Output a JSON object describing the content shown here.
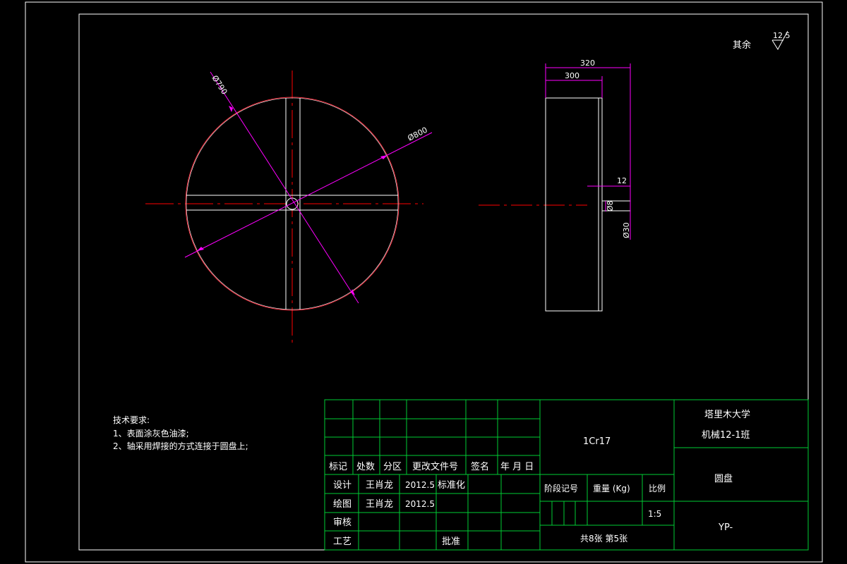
{
  "colors": {
    "background": "#000000",
    "outline": "#ffffff",
    "dimension": "#ff00ff",
    "centerline": "#ff0000",
    "grid": "#00cc33"
  },
  "roughness": {
    "label": "其余",
    "value": "12.5"
  },
  "front_view": {
    "dim_diameter_790": "Ø790",
    "dim_diameter_800": "Ø800"
  },
  "side_view": {
    "dim_320": "320",
    "dim_300": "300",
    "dim_12": "12",
    "dim_small": "Ø8",
    "dim_30": "Ø30"
  },
  "notes": {
    "title": "技术要求:",
    "line1": "1、表面涂灰色油漆;",
    "line2": "2、轴采用焊接的方式连接于圆盘上;"
  },
  "title_block": {
    "headers": [
      "标记",
      "处数",
      "分区",
      "更改文件号",
      "签名",
      "年 月 日"
    ],
    "design_label": "设计",
    "design_name": "王肖龙",
    "design_date": "2012.5",
    "standard_label": "标准化",
    "draw_label": "绘图",
    "draw_name": "王肖龙",
    "draw_date": "2012.5",
    "review_label": "审核",
    "process_label": "工艺",
    "approve_label": "批准",
    "material": "1Cr17",
    "stage_label": "阶段记号",
    "weight_label": "重量 (Kg)",
    "scale_label": "比例",
    "scale_value": "1:5",
    "sheets": "共8张 第5张",
    "school": "塔里木大学",
    "class": "机械12-1班",
    "part_name": "圆盘",
    "drawing_no": "YP-"
  }
}
